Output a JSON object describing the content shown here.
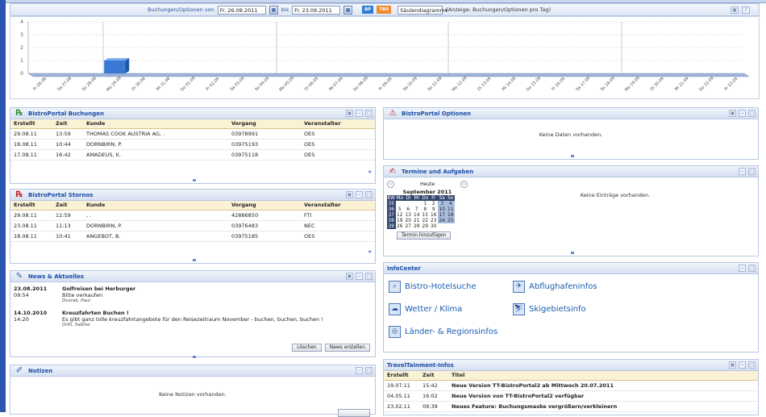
{
  "filter": {
    "label_from": "Buchungen/Optionen von",
    "date_from": "Fr. 26.08.2011",
    "label_to": "bis",
    "date_to": "Fr. 23.09.2011",
    "toggle_bp": "BP",
    "toggle_tbs": "TBS",
    "chart_type": "Säulendiagramm",
    "display_note": "(Anzeige: Buchungen/Optionen pro Tag)"
  },
  "chart_data": {
    "type": "bar",
    "categories": [
      "Fr 26.08",
      "Sa 27.08",
      "So 28.08",
      "Mo 29.08",
      "Di 30.08",
      "Mi 31.08",
      "Do 01.09",
      "Fr 02.09",
      "Sa 03.09",
      "So 04.09",
      "Mo 05.09",
      "Di 06.09",
      "Mi 07.09",
      "Do 08.09",
      "Fr 09.09",
      "Sa 10.09",
      "So 11.09",
      "Mo 12.09",
      "Di 13.09",
      "Mi 14.09",
      "Do 15.09",
      "Fr 16.09",
      "Sa 17.09",
      "So 18.09",
      "Mo 19.09",
      "Di 20.09",
      "Mi 21.09",
      "Do 22.09",
      "Fr 23.09"
    ],
    "values": [
      0,
      0,
      0,
      1,
      0,
      0,
      0,
      0,
      0,
      0,
      0,
      0,
      0,
      0,
      0,
      0,
      0,
      0,
      0,
      0,
      0,
      0,
      0,
      0,
      0,
      0,
      0,
      0,
      0
    ],
    "yticks": [
      "4",
      "3",
      "2",
      "1",
      "0"
    ],
    "ylim": [
      0,
      4
    ]
  },
  "buchungen": {
    "title": "BistroPortal Buchungen",
    "columns": [
      "Erstellt",
      "Zeit",
      "Kunde",
      "Vorgang",
      "Veranstalter"
    ],
    "rows": [
      [
        "29.08.11",
        "13:59",
        "THOMAS COOK AUSTRIA AG, .",
        "03978991",
        "OES"
      ],
      [
        "18.08.11",
        "10:44",
        "DORNBIRN, P.",
        "03975193",
        "OES"
      ],
      [
        "17.08.11",
        "16:42",
        "AMADEUS, K.",
        "03975118",
        "OES"
      ]
    ],
    "more": "»"
  },
  "stornos": {
    "title": "BistroPortal Stornos",
    "columns": [
      "Erstellt",
      "Zeit",
      "Kunde",
      "Vorgang",
      "Veranstalter"
    ],
    "rows": [
      [
        "29.08.11",
        "12:59",
        ", .",
        "42886850",
        "FTI"
      ],
      [
        "23.08.11",
        "11:13",
        "DORNBIRN, P.",
        "03976483",
        "NEC"
      ],
      [
        "18.08.11",
        "10:41",
        "ANGEBOT, B.",
        "03975185",
        "OES"
      ]
    ],
    "more": "»"
  },
  "news": {
    "title": "News & Aktuelles",
    "items": [
      {
        "date": "23.08.2011",
        "time": "09:54",
        "headline": "Golfreisen bei Herburger",
        "text": "Bitte verkaufen",
        "author": "Dvorak, Paul"
      },
      {
        "date": "14.10.2010",
        "time": "14:20",
        "headline": "Kreuzfahrten Buchen !",
        "text": "Es gibt ganz tolle kreuzfahrtangebote für den Reisezeitraum November - buchen, buchen, buchen !",
        "author": "Orth, Sabine"
      }
    ],
    "btn_delete": "Löschen",
    "btn_create": "News erstellen"
  },
  "notizen": {
    "title": "Notizen",
    "empty": "Keine Notizen vorhanden."
  },
  "optionen": {
    "title": "BistroPortal Optionen",
    "empty": "Keine Daten vorhanden."
  },
  "termine": {
    "title": "Termine und Aufgaben",
    "today": "Heute",
    "month": "September 2011",
    "weekdays": [
      "KW",
      "Mo",
      "Di",
      "Mi",
      "Do",
      "Fr",
      "Sa",
      "So"
    ],
    "weeks": [
      [
        "35",
        "",
        "",
        "",
        "1",
        "2",
        "3",
        "4"
      ],
      [
        "36",
        "5",
        "6",
        "7",
        "8",
        "9",
        "10",
        "11"
      ],
      [
        "37",
        "12",
        "13",
        "14",
        "15",
        "16",
        "17",
        "18"
      ],
      [
        "38",
        "19",
        "20",
        "21",
        "22",
        "23",
        "24",
        "25"
      ],
      [
        "39",
        "26",
        "27",
        "28",
        "29",
        "30",
        "",
        ""
      ]
    ],
    "add_button": "Termin hinzufügen",
    "empty": "Keine Einträge vorhanden."
  },
  "infocenter": {
    "title": "InfoCenter",
    "links": [
      "Bistro-Hotelsuche",
      "Abflughafeninfos",
      "Wetter / Klima",
      "Skigebietsinfo",
      "Länder- & Regionsinfos"
    ]
  },
  "tt_infos": {
    "title": "TravelTainment-Infos",
    "columns": [
      "Erstellt",
      "Zeit",
      "Titel"
    ],
    "rows": [
      [
        "19.07.11",
        "15:42",
        "Neue Version TT-BistroPortal2 ab Mittwoch 20.07.2011"
      ],
      [
        "04.05.11",
        "16:02",
        "Neue Version von TT-BistroPortal2 verfügbar"
      ],
      [
        "23.02.11",
        "09:39",
        "Neues Feature: Buchungsmaske vergrößern/verkleinern"
      ]
    ]
  },
  "colors": {
    "accent": "#1b4ca6",
    "bar": "#3a78d6",
    "table_header": "#fbf2d6",
    "sidebar": "#2a56b0"
  }
}
